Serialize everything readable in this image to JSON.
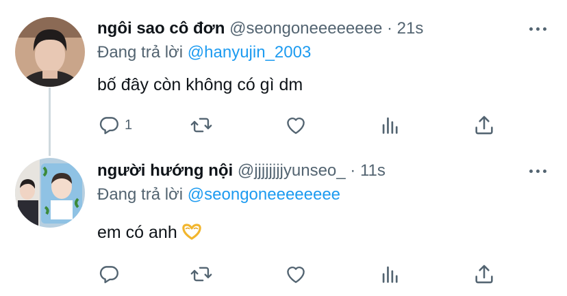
{
  "tweets": [
    {
      "display_name": "ngôi sao cô đơn",
      "handle": "@seongoneeeeeeee",
      "dot": "·",
      "time": "21s",
      "replying_prefix": "Đang trả lời ",
      "replying_to": "@hanyujin_2003",
      "text": "bố đây còn không có gì dm",
      "reply_count": "1"
    },
    {
      "display_name": "người hướng nội",
      "handle": "@jjjjjjjjyunseo_",
      "dot": "·",
      "time": "11s",
      "replying_prefix": "Đang trả lời ",
      "replying_to": "@seongoneeeeeeee",
      "text": "em có anh",
      "emoji": "heart-hands-emoji",
      "reply_count": ""
    }
  ],
  "colors": {
    "accent": "#1d9bf0",
    "secondary": "#536471",
    "text": "#0f1419",
    "thread_line": "#cfd9de"
  },
  "icons": [
    "reply-icon",
    "retweet-icon",
    "like-icon",
    "analytics-icon",
    "share-icon",
    "more-options-icon"
  ]
}
